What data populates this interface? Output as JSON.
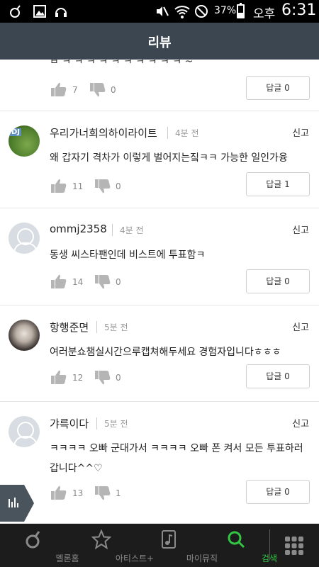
{
  "status_bar": {
    "battery_percent": "37%",
    "ampm": "오후",
    "time": "6:31"
  },
  "header": {
    "title": "리뷰"
  },
  "partial_comment": {
    "text": "ㅂ ㅋ ㅋ ㅋ ㅋ ㅋ ㅋ ㅋ ㅋ ㅋ ㅋ ~",
    "likes": "7",
    "dislikes": "0",
    "reply_label": "답글 0"
  },
  "comments": [
    {
      "user": "우리가너희의하이라이트",
      "time": "4분 전",
      "report": "신고",
      "text": "왜 갑자기 격차가 이렇게 벌어지는짘ㅋㅋ 가능한 일인가융",
      "likes": "11",
      "dislikes": "0",
      "reply_label": "답글 1"
    },
    {
      "user": "ommj2358",
      "time": "4분 전",
      "report": "신고",
      "text": "동생 씨스타팬인데 비스트에 투표함ㅋ",
      "likes": "14",
      "dislikes": "0",
      "reply_label": "답글 0"
    },
    {
      "user": "항행준면",
      "time": "5분 전",
      "report": "신고",
      "text": "여러분쇼챔실시간으루캡쳐해두세요 경험자입니다ㅎㅎㅎ",
      "likes": "12",
      "dislikes": "0",
      "reply_label": "답글 0"
    },
    {
      "user": "갸륵이다",
      "time": "5분 전",
      "report": "신고",
      "text": "ㅋㅋㅋㅋ 오빠 군대가서 ㅋㅋㅋㅋ 오빠 폰 켜서 모든 투표하러갑니다^^♡",
      "likes": "13",
      "dislikes": "1",
      "reply_label": "답글 0"
    }
  ],
  "bottom_nav": {
    "items": [
      {
        "label": "멜론홈",
        "icon": "melon-note-icon"
      },
      {
        "label": "아티스트+",
        "icon": "star-icon"
      },
      {
        "label": "마이뮤직",
        "icon": "music-file-icon"
      },
      {
        "label": "검색",
        "icon": "search-icon",
        "active": true
      }
    ],
    "more_icon": "grid-icon"
  },
  "colors": {
    "header_bg": "#3b4650",
    "nav_bg": "#1c1c1c",
    "active_accent": "#32c642"
  }
}
